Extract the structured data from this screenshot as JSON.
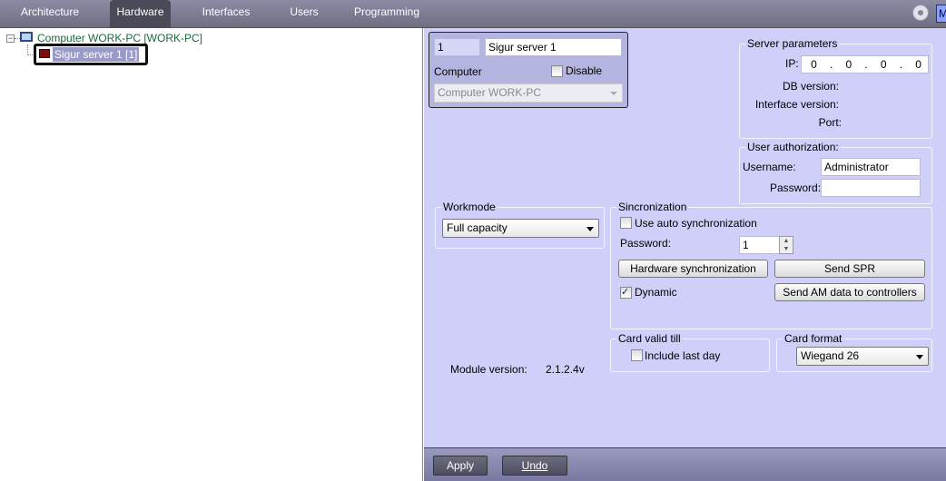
{
  "tabs": [
    {
      "label": "Architecture"
    },
    {
      "label": "Hardware"
    },
    {
      "label": "Interfaces"
    },
    {
      "label": "Users"
    },
    {
      "label": "Programming"
    }
  ],
  "topbar": {
    "right_badge": "M"
  },
  "tree": {
    "computer": "Computer WORK-PC [WORK-PC]",
    "server": "Sigur server 1 [1]"
  },
  "object": {
    "id": "1",
    "name": "Sigur server 1",
    "computer_label": "Computer",
    "disable_label": "Disable",
    "computer_value": "Computer WORK-PC"
  },
  "server_params": {
    "title": "Server parameters",
    "ip_label": "IP:",
    "ip": [
      "0",
      "0",
      "0",
      "0"
    ],
    "db_version_label": "DB version:",
    "interface_version_label": "Interface version:",
    "port_label": "Port:"
  },
  "auth": {
    "title": "User authorization:",
    "username_label": "Username:",
    "username": "Administrator",
    "password_label": "Password:"
  },
  "workmode": {
    "title": "Workmode",
    "value": "Full capacity"
  },
  "sync": {
    "title": "Sincronization",
    "auto_label": "Use auto synchronization",
    "password_label": "Password:",
    "password_value": "1",
    "hw_sync": "Hardware synchronization",
    "send_spr": "Send SPR",
    "dynamic_label": "Dynamic",
    "send_am": "Send AM data to controllers"
  },
  "card_valid": {
    "title": "Card valid till",
    "include_label": "Include last day"
  },
  "card_format": {
    "title": "Card format",
    "value": "Wiegand 26"
  },
  "module": {
    "label": "Module version:",
    "value": "2.1.2.4v"
  },
  "footer": {
    "apply": "Apply",
    "undo": "Undo"
  }
}
